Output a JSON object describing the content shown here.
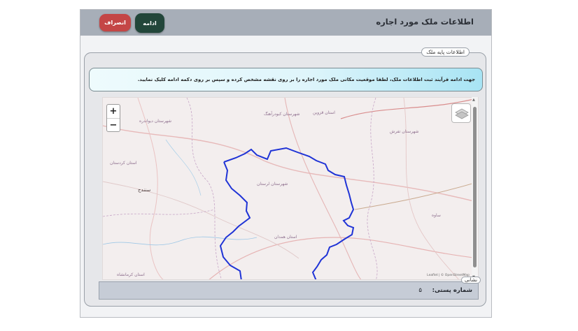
{
  "header": {
    "title": "اطلاعات ملک مورد اجاره",
    "continue_label": "ادامه",
    "cancel_label": "انصراف"
  },
  "section": {
    "legend": "اطلاعات پایه ملک",
    "instruction": "جهت ادامه فرآیند ثبت اطلاعات ملک، لطفا موقعیت مکانی ملک مورد اجاره را بر روی نقشه مشخص کرده و سپس بر روی دکمه ادامه کلیک نمایید."
  },
  "map": {
    "zoom_in": "+",
    "zoom_out": "−",
    "labels": {
      "a": "سنندج",
      "b": "استان کردستان",
      "c": "استان همدان",
      "d": "شهرستان لرستان",
      "e": "استان قزوین",
      "f": "ساوه",
      "g": "استان کرمانشاه",
      "h": "شهرستان تفرش",
      "i": "شهرستان کبودرآهنگ",
      "j": "شهرستان دیواندره"
    },
    "attribution": "Leaflet | © OpenStreetMap"
  },
  "postal": {
    "label": "شماره پستی:",
    "value": "۵"
  },
  "address_legend": "نشانی",
  "colors": {
    "header": "#a7aeb8",
    "continue": "#22463a",
    "cancel": "#c44646",
    "boundary": "#1f33d6"
  }
}
